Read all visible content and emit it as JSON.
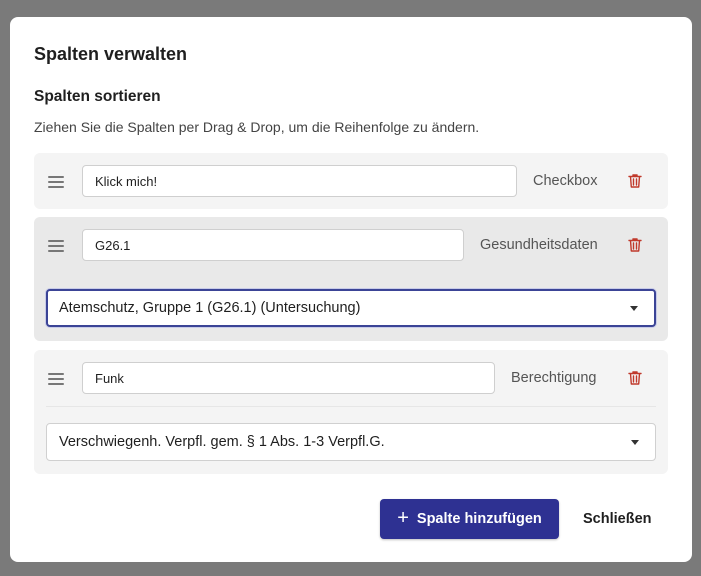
{
  "dialog": {
    "title": "Spalten verwalten",
    "subtitle": "Spalten sortieren",
    "hint": "Ziehen Sie die Spalten per Drag & Drop, um die Reihenfolge zu ändern."
  },
  "columns": [
    {
      "name": "Klick mich!",
      "type": "Checkbox"
    },
    {
      "name": "G26.1",
      "type": "Gesundheitsdaten",
      "select_value": "Atemschutz, Gruppe 1 (G26.1) (Untersuchung)"
    },
    {
      "name": "Funk",
      "type": "Berechtigung",
      "select_value": "Verschwiegenh. Verpfl. gem. § 1 Abs. 1-3 Verpfl.G."
    }
  ],
  "actions": {
    "add_column_label": "Spalte hinzufügen",
    "add_icon": "plus-icon",
    "close_label": "Schließen"
  },
  "colors": {
    "primary": "#2e3192",
    "danger": "#c0392b",
    "focus_ring": "#3b4496"
  },
  "icons": {
    "drag": "drag-handle-icon",
    "delete": "trash-icon",
    "dropdown": "chevron-down-icon"
  }
}
